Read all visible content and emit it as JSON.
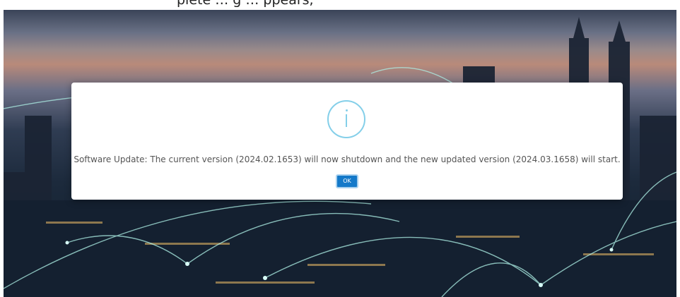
{
  "header": {
    "partial_text": "plete … g  …  ppears,"
  },
  "background": {
    "icon": "city-skyline-network-image"
  },
  "dialog": {
    "icon": "info-icon",
    "icon_color": "#84cfe9",
    "message": "Software Update: The current version (2024.02.1653) will now shutdown and the new updated version (2024.03.1658) will start.",
    "ok_label": "OK",
    "ok_color": "#1479c9"
  }
}
